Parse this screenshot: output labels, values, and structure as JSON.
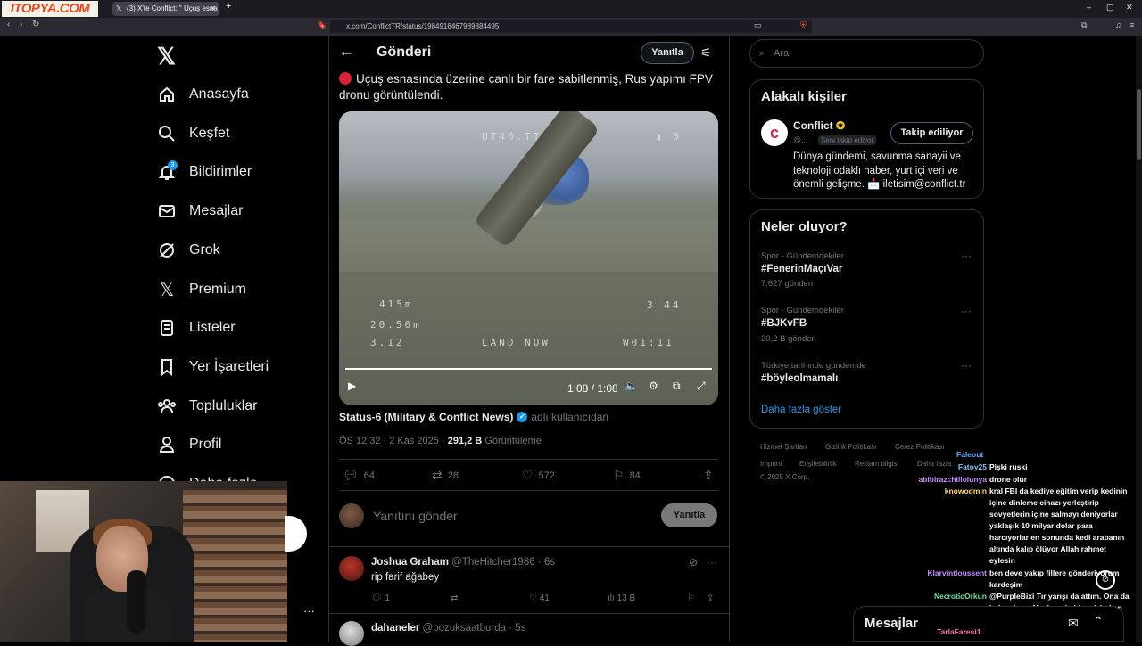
{
  "browser": {
    "logo_text": "ITOPYA.COM",
    "tab_title": "(3) X'te Conflict: \" Uçuş esna",
    "url": "x.com/ConflictTR/status/1984916467989884495"
  },
  "sidebar": {
    "items": [
      {
        "label": "Anasayfa",
        "icon": "home-icon"
      },
      {
        "label": "Keşfet",
        "icon": "search-icon"
      },
      {
        "label": "Bildirimler",
        "icon": "bell-icon"
      },
      {
        "label": "Mesajlar",
        "icon": "mail-icon"
      },
      {
        "label": "Grok",
        "icon": "grok-icon"
      },
      {
        "label": "Premium",
        "icon": "x-icon"
      },
      {
        "label": "Listeler",
        "icon": "list-icon"
      },
      {
        "label": "Yer İşaretleri",
        "icon": "bookmark-icon"
      },
      {
        "label": "Topluluklar",
        "icon": "people-icon"
      },
      {
        "label": "Profil",
        "icon": "person-icon"
      },
      {
        "label": "Daha fazla",
        "icon": "more-icon"
      }
    ],
    "notification_count": "3"
  },
  "post": {
    "header_title": "Gönderi",
    "reply_button": "Yanıtla",
    "text": "Uçuş esnasında üzerine canlı bir fare sabitlenmiş, Rus yapımı FPV dronu görüntülendi.",
    "video": {
      "time": "1:08 / 1:08",
      "osd_top": "UT40.TT",
      "osd_top_right": "▮  0",
      "osd_l1": "415m",
      "osd_l2": "20.50m",
      "osd_l3": "3.12",
      "osd_mid": "LAND NOW",
      "osd_right": "W01:11",
      "osd_r1": "3 44",
      "progress": 1.0
    },
    "author_name": "Status-6 (Military & Conflict News)",
    "author_via": "adlı kullanıcıdan",
    "time": "ÖS 12:32 · 2 Kas 2025 ·",
    "views": "291,2 B",
    "views_label": "Görüntüleme",
    "stats": {
      "replies": "64",
      "reposts": "28",
      "likes": "572",
      "bookmarks": "84"
    },
    "reply_placeholder": "Yanıtını gönder",
    "reply_submit": "Yanıtla"
  },
  "replies": [
    {
      "name": "Joshua Graham",
      "handle": "@TheHitcher1986 · 6s",
      "text": "rip farif ağabey",
      "replies": "1",
      "likes": "41",
      "views": "13 B"
    },
    {
      "name": "dahaneler",
      "handle": "@bozuksaatburda · 5s",
      "text": ""
    }
  ],
  "right": {
    "search_placeholder": "Ara",
    "related_title": "Alakalı kişiler",
    "related": {
      "name": "Conflict",
      "handle": "@...",
      "follows_you": "Seni takip ediyor",
      "follow_button": "Takip ediliyor",
      "bio": "Dünya gündemi, savunma sanayii ve teknoloji odaklı haber, yurt içi veri ve önemli gelişme. 📩 iletisim@conflict.tr"
    },
    "trends_title": "Neler oluyor?",
    "trends": [
      {
        "category": "Spor · Gündemdekiler",
        "name": "#FenerinMaçıVar",
        "count": "7.627 gönderi"
      },
      {
        "category": "Spor · Gündemdekiler",
        "name": "#BJKvFB",
        "count": "20,2 B gönderi"
      },
      {
        "category": "Türkiye tarihinde gündemde",
        "name": "#böyleolmamalı",
        "count": ""
      }
    ],
    "show_more": "Daha fazla göster",
    "footer": {
      "l1": [
        "Hizmet Şartları",
        "Gizlilik Politikası",
        "Çerez Politikası"
      ],
      "l2": [
        "Imprint",
        "Erişilebilirlik",
        "Reklam bilgisi",
        "Daha fazla"
      ],
      "copyright": "© 2025 X Corp."
    }
  },
  "chat": [
    {
      "user": "Faleout",
      "color": "#5fa8ff",
      "msg": ""
    },
    {
      "user": "Fatoy25",
      "color": "#7ec8ff",
      "msg": "Pişki ruski"
    },
    {
      "user": "abibirazchillolunya",
      "color": "#c58aff",
      "msg": "drone olur"
    },
    {
      "user": "knowodmin",
      "color": "#ffd36b",
      "msg": "kral FBI da kediye eğitim verip kedinin içine dinleme cihazı yerleştirip sovyetlerin içine salmayı deniyorlar yaklaşık 10 milyar dolar para harcıyorlar en sonunda kedi arabanın altında kalıp ölüyor Allah rahmet eylesin"
    },
    {
      "user": "Klarvintloussent",
      "color": "#c58aff",
      "msg": "ben deve yakıp fillere gönderiyorum kardeşim"
    },
    {
      "user": "NecroticOrkun",
      "color": "#6fe0a0",
      "msg": "@PurpleBixi Tır yarışı da attım. Ona da bakmalısın. Ne deşarj oldum izlerken"
    },
    {
      "user": "TarlaFaresi1",
      "color": "#ff7aa8",
      "msg": ""
    }
  ],
  "messages_bar": "Mesajlar",
  "colors": {
    "accent": "#1d9bf0",
    "bg": "#000000",
    "border": "#2f3336"
  }
}
